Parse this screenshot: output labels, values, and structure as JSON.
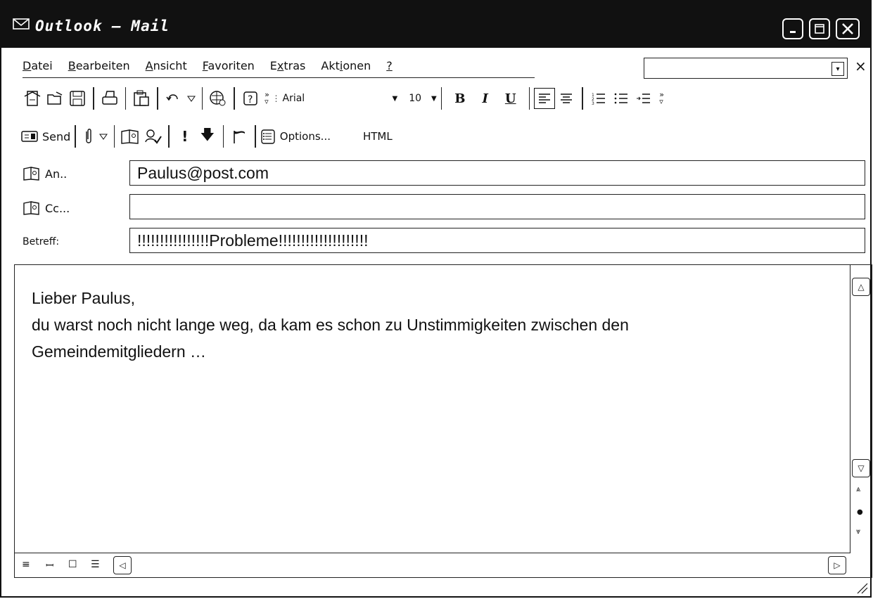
{
  "window": {
    "title": "Outlook – Mail"
  },
  "menu": {
    "items": [
      {
        "pre": "",
        "key": "D",
        "post": "atei"
      },
      {
        "pre": "",
        "key": "B",
        "post": "earbeiten"
      },
      {
        "pre": "",
        "key": "A",
        "post": "nsicht"
      },
      {
        "pre": "",
        "key": "F",
        "post": "avoriten"
      },
      {
        "pre": "E",
        "key": "x",
        "post": "tras"
      },
      {
        "pre": "Akt",
        "key": "i",
        "post": "onen"
      },
      {
        "pre": "",
        "key": "?",
        "post": ""
      }
    ],
    "close_glyph": "×"
  },
  "format_toolbar": {
    "font": "Arial",
    "size": "10",
    "bold": "B",
    "italic": "I",
    "underline": "U"
  },
  "send_toolbar": {
    "send_label": "Send",
    "options_label": "Options...",
    "html_label": "HTML"
  },
  "fields": {
    "to": {
      "label": "An..",
      "value": "Paulus@post.com"
    },
    "cc": {
      "label": "Cc...",
      "value": ""
    },
    "subject": {
      "label": "Betreff:",
      "value": "!!!!!!!!!!!!!!!!Probleme!!!!!!!!!!!!!!!!!!!!"
    }
  },
  "body": {
    "greeting": "Lieber Paulus,",
    "line1": "du warst noch nicht lange weg, da kam es schon zu Unstimmigkeiten zwischen den",
    "line2": "Gemeindemitgliedern …"
  }
}
